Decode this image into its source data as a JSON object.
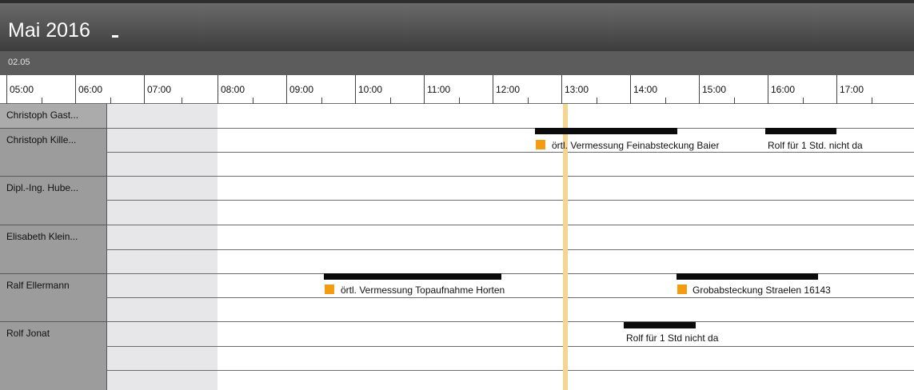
{
  "header": {
    "month_title": "Mai 2016"
  },
  "day": {
    "label": "02.05"
  },
  "ruler": {
    "hours": [
      "05:00",
      "06:00",
      "07:00",
      "08:00",
      "09:00",
      "10:00",
      "11:00",
      "12:00",
      "13:00",
      "14:00",
      "15:00",
      "16:00",
      "17:00"
    ]
  },
  "resources": [
    "Christoph Gast...",
    "Christoph Kille...",
    "Dipl.-Ing. Hube...",
    "Elisabeth Klein...",
    "Ralf Ellermann",
    "Rolf Jonat"
  ],
  "events": [
    {
      "label": "örtl. Vermessung Feinabsteckung Baier",
      "start": "12:20",
      "end": "14:25",
      "resource": "Christoph Kille...",
      "marker": true
    },
    {
      "label": "Rolf für 1 Std. nicht da",
      "start": "15:35",
      "end": "16:40",
      "resource": "Christoph Kille...",
      "marker": false
    },
    {
      "label": "örtl. Vermessung Topaufnahme Horten",
      "start": "09:20",
      "end": "11:55",
      "resource": "Ralf Ellermann",
      "marker": true
    },
    {
      "label": "Grobabsteckung Straelen 16143",
      "start": "14:25",
      "end": "16:30",
      "resource": "Ralf Ellermann",
      "marker": true
    },
    {
      "label": "Rolf für 1 Std nicht da",
      "start": "13:45",
      "end": "14:50",
      "resource": "Rolf Jonat",
      "marker": false
    }
  ],
  "current_time": "12:45",
  "colors": {
    "event_bar": "#0b0b0b",
    "event_marker": "#f39c12",
    "now_line": "#f5d592"
  }
}
